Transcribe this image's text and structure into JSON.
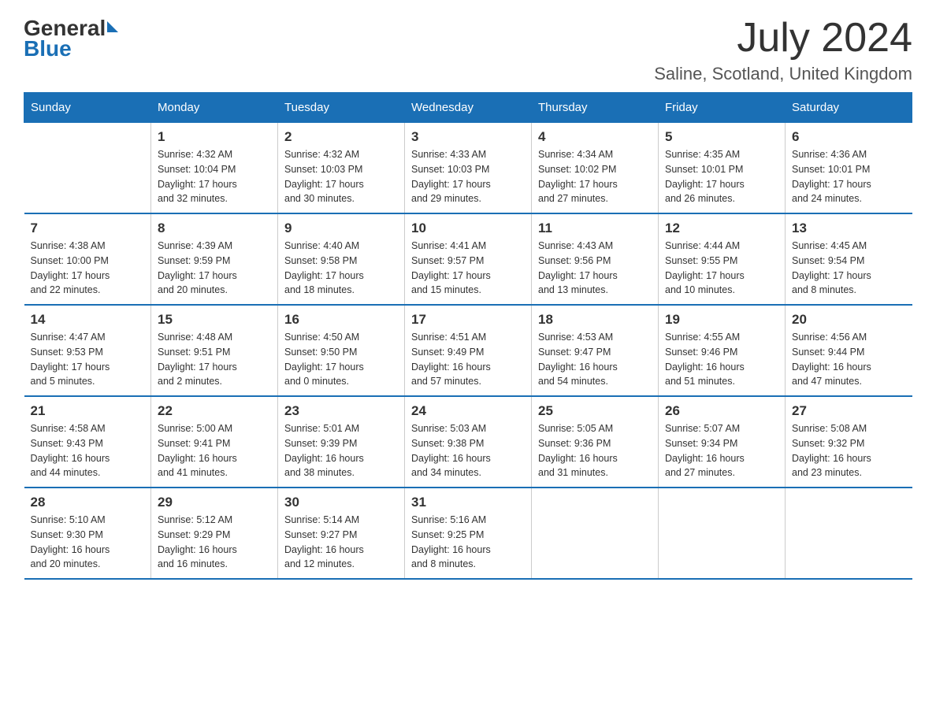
{
  "header": {
    "logo_general": "General",
    "logo_blue": "Blue",
    "month_title": "July 2024",
    "location": "Saline, Scotland, United Kingdom"
  },
  "days_of_week": [
    "Sunday",
    "Monday",
    "Tuesday",
    "Wednesday",
    "Thursday",
    "Friday",
    "Saturday"
  ],
  "weeks": [
    [
      {
        "num": "",
        "info": ""
      },
      {
        "num": "1",
        "info": "Sunrise: 4:32 AM\nSunset: 10:04 PM\nDaylight: 17 hours\nand 32 minutes."
      },
      {
        "num": "2",
        "info": "Sunrise: 4:32 AM\nSunset: 10:03 PM\nDaylight: 17 hours\nand 30 minutes."
      },
      {
        "num": "3",
        "info": "Sunrise: 4:33 AM\nSunset: 10:03 PM\nDaylight: 17 hours\nand 29 minutes."
      },
      {
        "num": "4",
        "info": "Sunrise: 4:34 AM\nSunset: 10:02 PM\nDaylight: 17 hours\nand 27 minutes."
      },
      {
        "num": "5",
        "info": "Sunrise: 4:35 AM\nSunset: 10:01 PM\nDaylight: 17 hours\nand 26 minutes."
      },
      {
        "num": "6",
        "info": "Sunrise: 4:36 AM\nSunset: 10:01 PM\nDaylight: 17 hours\nand 24 minutes."
      }
    ],
    [
      {
        "num": "7",
        "info": "Sunrise: 4:38 AM\nSunset: 10:00 PM\nDaylight: 17 hours\nand 22 minutes."
      },
      {
        "num": "8",
        "info": "Sunrise: 4:39 AM\nSunset: 9:59 PM\nDaylight: 17 hours\nand 20 minutes."
      },
      {
        "num": "9",
        "info": "Sunrise: 4:40 AM\nSunset: 9:58 PM\nDaylight: 17 hours\nand 18 minutes."
      },
      {
        "num": "10",
        "info": "Sunrise: 4:41 AM\nSunset: 9:57 PM\nDaylight: 17 hours\nand 15 minutes."
      },
      {
        "num": "11",
        "info": "Sunrise: 4:43 AM\nSunset: 9:56 PM\nDaylight: 17 hours\nand 13 minutes."
      },
      {
        "num": "12",
        "info": "Sunrise: 4:44 AM\nSunset: 9:55 PM\nDaylight: 17 hours\nand 10 minutes."
      },
      {
        "num": "13",
        "info": "Sunrise: 4:45 AM\nSunset: 9:54 PM\nDaylight: 17 hours\nand 8 minutes."
      }
    ],
    [
      {
        "num": "14",
        "info": "Sunrise: 4:47 AM\nSunset: 9:53 PM\nDaylight: 17 hours\nand 5 minutes."
      },
      {
        "num": "15",
        "info": "Sunrise: 4:48 AM\nSunset: 9:51 PM\nDaylight: 17 hours\nand 2 minutes."
      },
      {
        "num": "16",
        "info": "Sunrise: 4:50 AM\nSunset: 9:50 PM\nDaylight: 17 hours\nand 0 minutes."
      },
      {
        "num": "17",
        "info": "Sunrise: 4:51 AM\nSunset: 9:49 PM\nDaylight: 16 hours\nand 57 minutes."
      },
      {
        "num": "18",
        "info": "Sunrise: 4:53 AM\nSunset: 9:47 PM\nDaylight: 16 hours\nand 54 minutes."
      },
      {
        "num": "19",
        "info": "Sunrise: 4:55 AM\nSunset: 9:46 PM\nDaylight: 16 hours\nand 51 minutes."
      },
      {
        "num": "20",
        "info": "Sunrise: 4:56 AM\nSunset: 9:44 PM\nDaylight: 16 hours\nand 47 minutes."
      }
    ],
    [
      {
        "num": "21",
        "info": "Sunrise: 4:58 AM\nSunset: 9:43 PM\nDaylight: 16 hours\nand 44 minutes."
      },
      {
        "num": "22",
        "info": "Sunrise: 5:00 AM\nSunset: 9:41 PM\nDaylight: 16 hours\nand 41 minutes."
      },
      {
        "num": "23",
        "info": "Sunrise: 5:01 AM\nSunset: 9:39 PM\nDaylight: 16 hours\nand 38 minutes."
      },
      {
        "num": "24",
        "info": "Sunrise: 5:03 AM\nSunset: 9:38 PM\nDaylight: 16 hours\nand 34 minutes."
      },
      {
        "num": "25",
        "info": "Sunrise: 5:05 AM\nSunset: 9:36 PM\nDaylight: 16 hours\nand 31 minutes."
      },
      {
        "num": "26",
        "info": "Sunrise: 5:07 AM\nSunset: 9:34 PM\nDaylight: 16 hours\nand 27 minutes."
      },
      {
        "num": "27",
        "info": "Sunrise: 5:08 AM\nSunset: 9:32 PM\nDaylight: 16 hours\nand 23 minutes."
      }
    ],
    [
      {
        "num": "28",
        "info": "Sunrise: 5:10 AM\nSunset: 9:30 PM\nDaylight: 16 hours\nand 20 minutes."
      },
      {
        "num": "29",
        "info": "Sunrise: 5:12 AM\nSunset: 9:29 PM\nDaylight: 16 hours\nand 16 minutes."
      },
      {
        "num": "30",
        "info": "Sunrise: 5:14 AM\nSunset: 9:27 PM\nDaylight: 16 hours\nand 12 minutes."
      },
      {
        "num": "31",
        "info": "Sunrise: 5:16 AM\nSunset: 9:25 PM\nDaylight: 16 hours\nand 8 minutes."
      },
      {
        "num": "",
        "info": ""
      },
      {
        "num": "",
        "info": ""
      },
      {
        "num": "",
        "info": ""
      }
    ]
  ]
}
